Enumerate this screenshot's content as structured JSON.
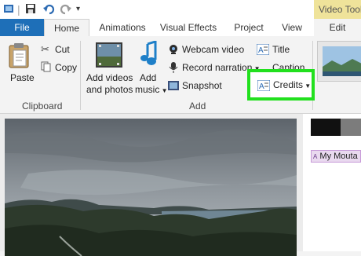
{
  "titlebar": {
    "context_tab": "Video Tools"
  },
  "tabs": [
    "File",
    "Home",
    "Animations",
    "Visual Effects",
    "Project",
    "View",
    "Edit"
  ],
  "clipboard": {
    "paste": "Paste",
    "cut": "Cut",
    "copy": "Copy",
    "group": "Clipboard"
  },
  "add": {
    "add_videos_line1": "Add videos",
    "add_videos_line2": "and photos",
    "add_music_line1": "Add",
    "add_music_line2": "music",
    "webcam": "Webcam video",
    "record": "Record narration",
    "snapshot": "Snapshot",
    "title": "Title",
    "caption": "Caption",
    "credits": "Credits",
    "group": "Add"
  },
  "storyboard": {
    "clip_title": "My Mouta"
  },
  "colors": {
    "file_tab": "#1e6fb8",
    "context_tab": "#efe39a",
    "highlight": "#22e01e"
  }
}
